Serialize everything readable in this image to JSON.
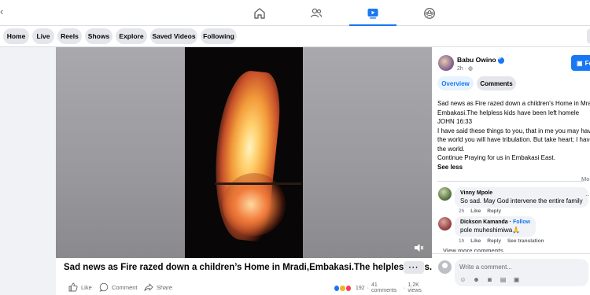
{
  "nav": {
    "icons": [
      "home-icon",
      "friends-icon",
      "watch-icon",
      "groups-icon"
    ],
    "active": "watch-icon"
  },
  "chips": [
    "Home",
    "Live",
    "Reels",
    "Shows",
    "Explore",
    "Saved Videos",
    "Following"
  ],
  "video": {
    "title": "Sad news as Fire razed down a children’s Home in Mradi,Embakasi.The helpless kids...",
    "more": "···",
    "actions": {
      "like": "Like",
      "comment": "Comment",
      "share": "Share"
    },
    "stats": {
      "reactions": "192",
      "comments": "41 comments",
      "views": "1.2K views"
    }
  },
  "panel": {
    "author": "Babu Owino",
    "time": "2h · ",
    "follow_label": "Fo",
    "tabs": {
      "overview": "Overview",
      "comments": "Comments"
    },
    "description": [
      "Sad news as Fire razed down a children's Home in Mradi,Embakasi.",
      "Embakasi.The helpless kids have been left homele",
      "JOHN 16:33",
      "I have said these things to you, that in me you may have",
      "the world you will have tribulation. But take heart; I have",
      "the world.",
      "Continue Praying for us in Embakasi East."
    ],
    "see_less": "See less",
    "most_relevant": "Mo",
    "comments": [
      {
        "name": "Vinny Mpole",
        "text": "So sad. May God intervene the entire family",
        "time": "2h",
        "like": "Like",
        "reply": "Reply"
      },
      {
        "name": "Dickson Kamanda",
        "follow": "Follow",
        "text": "pole muheshimiwa🙏",
        "time": "1h",
        "like": "Like",
        "reply": "Reply",
        "translate": "See translation"
      }
    ],
    "view_more": "View more comments",
    "write_placeholder": "Write a comment..."
  },
  "colors": {
    "accent": "#1877f2",
    "background": "#f0f2f5",
    "chip": "#e4e6eb"
  }
}
